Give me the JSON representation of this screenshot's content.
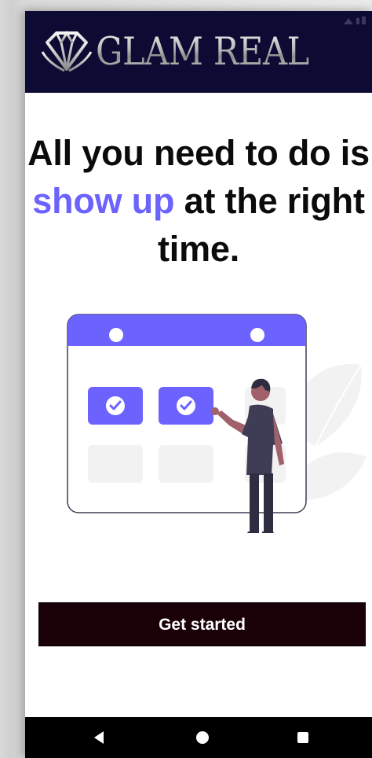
{
  "app_bar": {
    "brand": "GLAM REAL",
    "logo_icon": "diamond-icon",
    "background": "#0d0b33"
  },
  "headline": {
    "part1": "All you need to do is ",
    "accent": "show up",
    "part2": " at the right time.",
    "accent_color": "#6c63ff"
  },
  "illustration": {
    "icon": "calendar-checkmark-illustration"
  },
  "cta": {
    "label": "Get started",
    "background": "#1a0107"
  },
  "nav_bar": {
    "back_icon": "back-triangle-icon",
    "home_icon": "home-circle-icon",
    "recents_icon": "recents-square-icon"
  }
}
